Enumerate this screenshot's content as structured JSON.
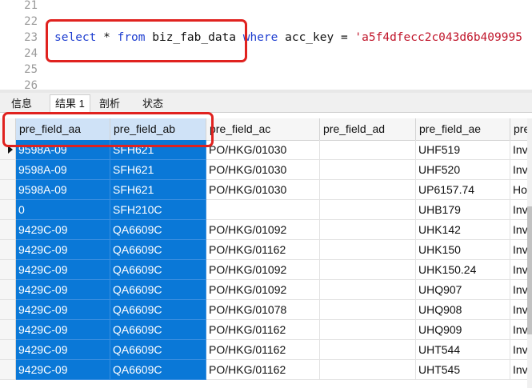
{
  "editor": {
    "lines": [
      {
        "num": "21",
        "code": []
      },
      {
        "num": "22",
        "code": []
      },
      {
        "num": "23",
        "code": [
          {
            "t": "select",
            "c": "kw"
          },
          {
            "t": " * ",
            "c": ""
          },
          {
            "t": "from",
            "c": "kw"
          },
          {
            "t": " biz_fab_data ",
            "c": ""
          },
          {
            "t": "where",
            "c": "kw"
          },
          {
            "t": " acc_key = ",
            "c": ""
          },
          {
            "t": "'a5f4dfecc2c043d6b409995",
            "c": "str"
          }
        ]
      },
      {
        "num": "24",
        "code": []
      },
      {
        "num": "25",
        "code": []
      },
      {
        "num": "26",
        "code": []
      }
    ]
  },
  "tabs": [
    {
      "label": "信息",
      "active": false
    },
    {
      "label": "结果 1",
      "active": true
    },
    {
      "label": "剖析",
      "active": false
    },
    {
      "label": "状态",
      "active": false
    }
  ],
  "grid": {
    "columns": [
      "pre_field_aa",
      "pre_field_ab",
      "pre_field_ac",
      "pre_field_ad",
      "pre_field_ae",
      "pre"
    ],
    "rows": [
      [
        "9598A-09",
        "SFH621",
        "PO/HKG/01030",
        "",
        "UHF519",
        "Inve"
      ],
      [
        "9598A-09",
        "SFH621",
        "PO/HKG/01030",
        "",
        "UHF520",
        "Inve"
      ],
      [
        "9598A-09",
        "SFH621",
        "PO/HKG/01030",
        "",
        "UP6157.74",
        "Ho"
      ],
      [
        "0",
        "SFH210C",
        "",
        "",
        "UHB179",
        "Inve"
      ],
      [
        "9429C-09",
        "QA6609C",
        "PO/HKG/01092",
        "",
        "UHK142",
        "Inve"
      ],
      [
        "9429C-09",
        "QA6609C",
        "PO/HKG/01162",
        "",
        "UHK150",
        "Inve"
      ],
      [
        "9429C-09",
        "QA6609C",
        "PO/HKG/01092",
        "",
        "UHK150.24",
        "Inve"
      ],
      [
        "9429C-09",
        "QA6609C",
        "PO/HKG/01092",
        "",
        "UHQ907",
        "Inve"
      ],
      [
        "9429C-09",
        "QA6609C",
        "PO/HKG/01078",
        "",
        "UHQ908",
        "Inve"
      ],
      [
        "9429C-09",
        "QA6609C",
        "PO/HKG/01162",
        "",
        "UHQ909",
        "Inve"
      ],
      [
        "9429C-09",
        "QA6609C",
        "PO/HKG/01162",
        "",
        "UHT544",
        "Inve"
      ],
      [
        "9429C-09",
        "QA6609C",
        "PO/HKG/01162",
        "",
        "UHT545",
        "Inve"
      ]
    ],
    "selected_columns": [
      0,
      1
    ],
    "current_row": 0
  },
  "colors": {
    "keyword": "#1f3fd0",
    "string": "#c0162b",
    "selection": "#0a78d7",
    "highlight_box": "#e0221f"
  }
}
